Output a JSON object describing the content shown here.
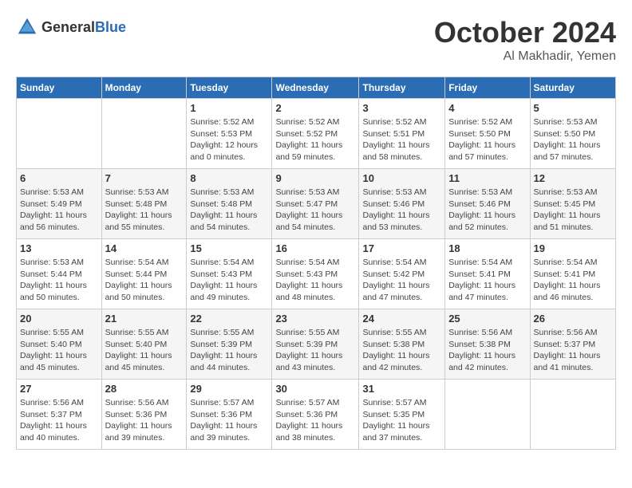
{
  "header": {
    "logo_general": "General",
    "logo_blue": "Blue",
    "month": "October 2024",
    "location": "Al Makhadir, Yemen"
  },
  "weekdays": [
    "Sunday",
    "Monday",
    "Tuesday",
    "Wednesday",
    "Thursday",
    "Friday",
    "Saturday"
  ],
  "weeks": [
    [
      {
        "day": "",
        "empty": true
      },
      {
        "day": "",
        "empty": true
      },
      {
        "day": "1",
        "sunrise": "5:52 AM",
        "sunset": "5:53 PM",
        "daylight": "12 hours and 0 minutes."
      },
      {
        "day": "2",
        "sunrise": "5:52 AM",
        "sunset": "5:52 PM",
        "daylight": "11 hours and 59 minutes."
      },
      {
        "day": "3",
        "sunrise": "5:52 AM",
        "sunset": "5:51 PM",
        "daylight": "11 hours and 58 minutes."
      },
      {
        "day": "4",
        "sunrise": "5:52 AM",
        "sunset": "5:50 PM",
        "daylight": "11 hours and 57 minutes."
      },
      {
        "day": "5",
        "sunrise": "5:53 AM",
        "sunset": "5:50 PM",
        "daylight": "11 hours and 57 minutes."
      }
    ],
    [
      {
        "day": "6",
        "sunrise": "5:53 AM",
        "sunset": "5:49 PM",
        "daylight": "11 hours and 56 minutes."
      },
      {
        "day": "7",
        "sunrise": "5:53 AM",
        "sunset": "5:48 PM",
        "daylight": "11 hours and 55 minutes."
      },
      {
        "day": "8",
        "sunrise": "5:53 AM",
        "sunset": "5:48 PM",
        "daylight": "11 hours and 54 minutes."
      },
      {
        "day": "9",
        "sunrise": "5:53 AM",
        "sunset": "5:47 PM",
        "daylight": "11 hours and 54 minutes."
      },
      {
        "day": "10",
        "sunrise": "5:53 AM",
        "sunset": "5:46 PM",
        "daylight": "11 hours and 53 minutes."
      },
      {
        "day": "11",
        "sunrise": "5:53 AM",
        "sunset": "5:46 PM",
        "daylight": "11 hours and 52 minutes."
      },
      {
        "day": "12",
        "sunrise": "5:53 AM",
        "sunset": "5:45 PM",
        "daylight": "11 hours and 51 minutes."
      }
    ],
    [
      {
        "day": "13",
        "sunrise": "5:53 AM",
        "sunset": "5:44 PM",
        "daylight": "11 hours and 50 minutes."
      },
      {
        "day": "14",
        "sunrise": "5:54 AM",
        "sunset": "5:44 PM",
        "daylight": "11 hours and 50 minutes."
      },
      {
        "day": "15",
        "sunrise": "5:54 AM",
        "sunset": "5:43 PM",
        "daylight": "11 hours and 49 minutes."
      },
      {
        "day": "16",
        "sunrise": "5:54 AM",
        "sunset": "5:43 PM",
        "daylight": "11 hours and 48 minutes."
      },
      {
        "day": "17",
        "sunrise": "5:54 AM",
        "sunset": "5:42 PM",
        "daylight": "11 hours and 47 minutes."
      },
      {
        "day": "18",
        "sunrise": "5:54 AM",
        "sunset": "5:41 PM",
        "daylight": "11 hours and 47 minutes."
      },
      {
        "day": "19",
        "sunrise": "5:54 AM",
        "sunset": "5:41 PM",
        "daylight": "11 hours and 46 minutes."
      }
    ],
    [
      {
        "day": "20",
        "sunrise": "5:55 AM",
        "sunset": "5:40 PM",
        "daylight": "11 hours and 45 minutes."
      },
      {
        "day": "21",
        "sunrise": "5:55 AM",
        "sunset": "5:40 PM",
        "daylight": "11 hours and 45 minutes."
      },
      {
        "day": "22",
        "sunrise": "5:55 AM",
        "sunset": "5:39 PM",
        "daylight": "11 hours and 44 minutes."
      },
      {
        "day": "23",
        "sunrise": "5:55 AM",
        "sunset": "5:39 PM",
        "daylight": "11 hours and 43 minutes."
      },
      {
        "day": "24",
        "sunrise": "5:55 AM",
        "sunset": "5:38 PM",
        "daylight": "11 hours and 42 minutes."
      },
      {
        "day": "25",
        "sunrise": "5:56 AM",
        "sunset": "5:38 PM",
        "daylight": "11 hours and 42 minutes."
      },
      {
        "day": "26",
        "sunrise": "5:56 AM",
        "sunset": "5:37 PM",
        "daylight": "11 hours and 41 minutes."
      }
    ],
    [
      {
        "day": "27",
        "sunrise": "5:56 AM",
        "sunset": "5:37 PM",
        "daylight": "11 hours and 40 minutes."
      },
      {
        "day": "28",
        "sunrise": "5:56 AM",
        "sunset": "5:36 PM",
        "daylight": "11 hours and 39 minutes."
      },
      {
        "day": "29",
        "sunrise": "5:57 AM",
        "sunset": "5:36 PM",
        "daylight": "11 hours and 39 minutes."
      },
      {
        "day": "30",
        "sunrise": "5:57 AM",
        "sunset": "5:36 PM",
        "daylight": "11 hours and 38 minutes."
      },
      {
        "day": "31",
        "sunrise": "5:57 AM",
        "sunset": "5:35 PM",
        "daylight": "11 hours and 37 minutes."
      },
      {
        "day": "",
        "empty": true
      },
      {
        "day": "",
        "empty": true
      }
    ]
  ]
}
